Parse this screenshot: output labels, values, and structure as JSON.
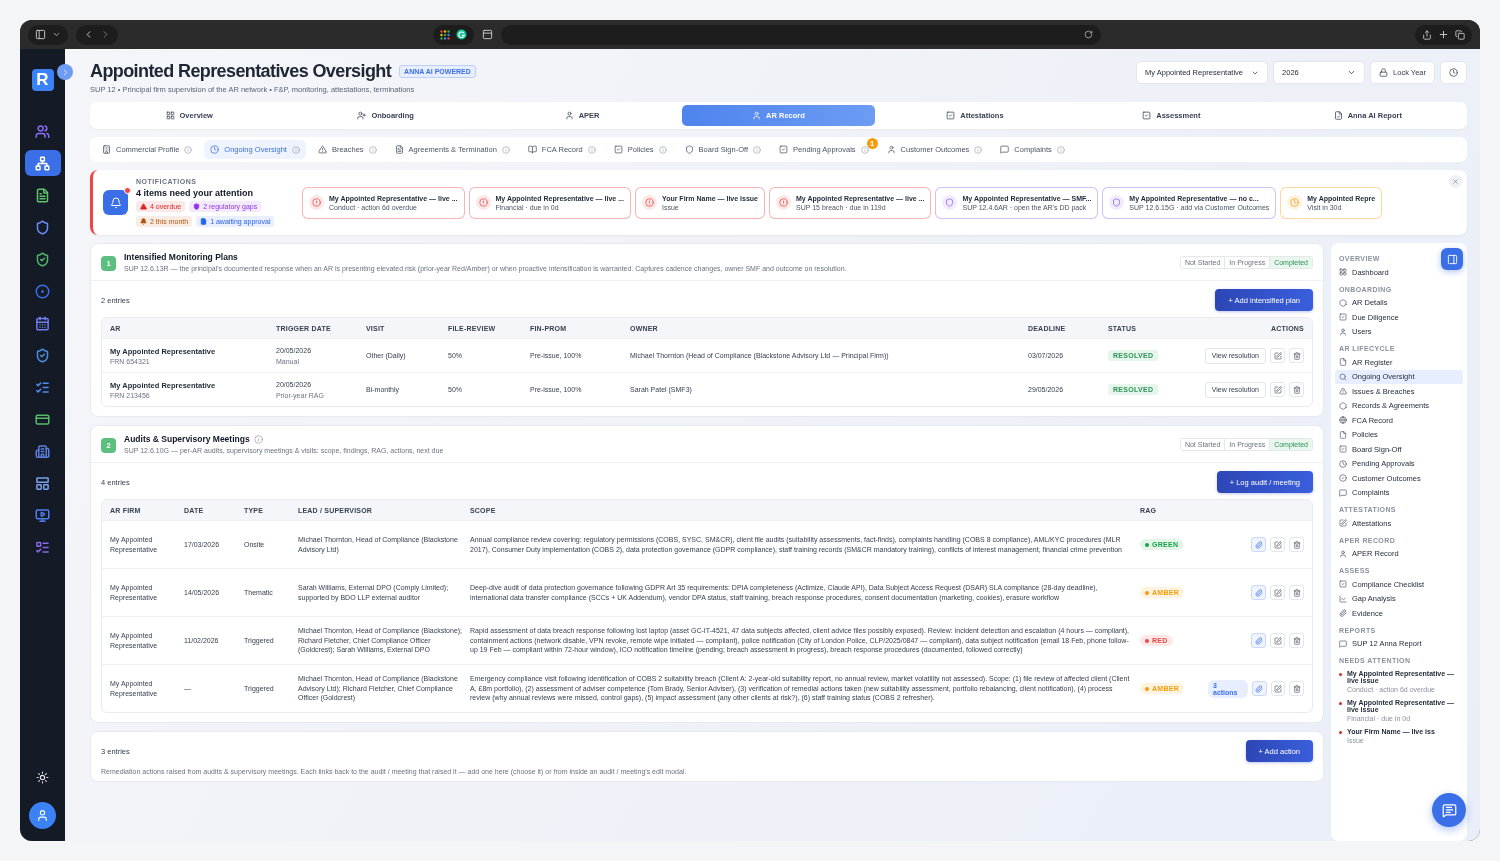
{
  "app": {
    "logo": "R"
  },
  "left_rail": {
    "items": [
      {
        "selected": false,
        "color": "#8b6cf6"
      },
      {
        "selected": true,
        "color": "#ffffff"
      },
      {
        "selected": false,
        "color": "#5cc46a"
      },
      {
        "selected": false,
        "color": "#6b8df5"
      },
      {
        "selected": false,
        "color": "#4fb86b"
      },
      {
        "selected": false,
        "color": "#3b6fe8"
      },
      {
        "selected": false,
        "color": "#6f7ff0"
      },
      {
        "selected": false,
        "color": "#4a90e2"
      },
      {
        "selected": false,
        "color": "#4f8bf0"
      },
      {
        "selected": false,
        "color": "#59b96a"
      },
      {
        "selected": false,
        "color": "#5a7fe0"
      },
      {
        "selected": false,
        "color": "#7aa0ee"
      },
      {
        "selected": false,
        "color": "#4f7df0"
      },
      {
        "selected": false,
        "color": "#8a67e8"
      }
    ]
  },
  "header": {
    "title": "Appointed Representatives Oversight",
    "badge": "ANNA AI POWERED",
    "subtitle": "SUP 12 • Principal firm supervision of the AR network • F&P, monitoring, attestations, terminations",
    "firm_select": "My Appointed Representative",
    "year_select": "2026",
    "lock_button": "Lock Year"
  },
  "tabs": [
    {
      "label": "Overview",
      "selected": false
    },
    {
      "label": "Onboarding",
      "selected": false
    },
    {
      "label": "APER",
      "selected": false
    },
    {
      "label": "AR Record",
      "selected": true
    },
    {
      "label": "Attestations",
      "selected": false
    },
    {
      "label": "Assessment",
      "selected": false
    },
    {
      "label": "Anna AI Report",
      "selected": false
    }
  ],
  "subtabs": [
    {
      "label": "Commercial Profile",
      "selected": false
    },
    {
      "label": "Ongoing Oversight",
      "selected": true
    },
    {
      "label": "Breaches",
      "selected": false
    },
    {
      "label": "Agreements & Termination",
      "selected": false
    },
    {
      "label": "FCA Record",
      "selected": false
    },
    {
      "label": "Policies",
      "selected": false
    },
    {
      "label": "Board Sign-Off",
      "selected": false
    },
    {
      "label": "Pending Approvals",
      "selected": false,
      "badge": "1"
    },
    {
      "label": "Customer Outcomes",
      "selected": false
    },
    {
      "label": "Complaints",
      "selected": false
    }
  ],
  "notifications": {
    "heading": "NOTIFICATIONS",
    "title": "4 items need your attention",
    "chips": [
      {
        "label": "4 overdue",
        "color": "#dc2626"
      },
      {
        "label": "2 regulatory gaps",
        "color": "#9333ea"
      },
      {
        "label": "2 this month",
        "color": "#b45309"
      },
      {
        "label": "1 awaiting approval",
        "color": "#2563eb"
      }
    ],
    "cards": [
      {
        "kind": "alert",
        "title": "My Appointed Representative — live ...",
        "detail": "Conduct · action 6d overdue"
      },
      {
        "kind": "alert",
        "title": "My Appointed Representative — live ...",
        "detail": "Financial · due in 0d"
      },
      {
        "kind": "alert",
        "title": "Your Firm Name — live issue",
        "detail": "Issue"
      },
      {
        "kind": "alert",
        "title": "My Appointed Representative — live ...",
        "detail": "SUP 15 breach · due in 119d"
      },
      {
        "kind": "shield",
        "title": "My Appointed Representative — SMF...",
        "detail": "SUP 12.4.6AR · open the AR's DD pack"
      },
      {
        "kind": "shield",
        "title": "My Appointed Representative — no c...",
        "detail": "SUP 12.6.15G · add via Customer Outcomes"
      },
      {
        "kind": "clock",
        "title": "My Appointed Repre",
        "detail": "Visit in 30d"
      }
    ]
  },
  "monitoring": {
    "number": "1",
    "title": "Intensified Monitoring Plans",
    "description": "SUP 12.6.13R — the principal's documented response when an AR is presenting elevated risk (prior-year Red/Amber) or when proactive intensification is warranted. Captures cadence changes, owner SMF and outcome on resolution.",
    "progress": [
      {
        "label": "Not Started",
        "selected": false
      },
      {
        "label": "In Progress",
        "selected": false
      },
      {
        "label": "Completed",
        "selected": true
      }
    ],
    "entries": "2 entries",
    "add_button": "+ Add intensified plan",
    "columns": [
      "AR",
      "TRIGGER DATE",
      "VISIT",
      "FILE-REVIEW",
      "FIN-PROM",
      "OWNER",
      "DEADLINE",
      "STATUS",
      "ACTIONS"
    ],
    "rows": [
      {
        "ar": "My Appointed Representative",
        "frn": "FRN 654321",
        "trigger_date": "20/05/2026",
        "trigger_note": "Manual",
        "visit": "Other (Daily)",
        "file_review": "50%",
        "fin_prom": "Pre-issue, 100%",
        "owner": "Michael Thornton (Head of Compliance (Blackstone Advisory Ltd — Principal Firm))",
        "deadline": "03/07/2026",
        "status": "RESOLVED",
        "action": "View resolution"
      },
      {
        "ar": "My Appointed Representative",
        "frn": "FRN 213456",
        "trigger_date": "20/05/2026",
        "trigger_note": "Prior-year RAG",
        "visit": "Bi-monthly",
        "file_review": "50%",
        "fin_prom": "Pre-issue, 100%",
        "owner": "Sarah Patel (SMF3)",
        "deadline": "29/05/2026",
        "status": "RESOLVED",
        "action": "View resolution"
      }
    ]
  },
  "audits": {
    "number": "2",
    "title": "Audits & Supervisory Meetings",
    "description": "SUP 12.6.10G — per-AR audits, supervisory meetings & visits: scope, findings, RAG, actions, next due",
    "progress": [
      {
        "label": "Not Started",
        "selected": false
      },
      {
        "label": "In Progress",
        "selected": false
      },
      {
        "label": "Completed",
        "selected": true
      }
    ],
    "entries": "4 entries",
    "add_button": "+ Log audit / meeting",
    "columns": [
      "AR FIRM",
      "DATE",
      "TYPE",
      "LEAD / SUPERVISOR",
      "SCOPE",
      "RAG"
    ],
    "rows": [
      {
        "ar_firm": "My Appointed Representative",
        "date": "17/03/2026",
        "type": "Onsite",
        "lead": "Michael Thornton, Head of Compliance (Blackstone Advisory Ltd)",
        "scope": "Annual compliance review covering: regulatory permissions (COBS, SYSC, SM&CR), client file audits (suitability assessments, fact-finds), complaints handling (COBS 8 compliance), AML/KYC procedures (MLR 2017), Consumer Duty implementation (COBS 2), data protection governance (GDPR compliance), staff training records (SM&CR mandatory training), conflicts of interest management, financial crime prevention",
        "rag": "GREEN",
        "color": "#16a34a"
      },
      {
        "ar_firm": "My Appointed Representative",
        "date": "14/05/2026",
        "type": "Thematic",
        "lead": "Sarah Williams, External DPO (Comply Limited); supported by BDO LLP external auditor",
        "scope": "Deep-dive audit of data protection governance following GDPR Art 35 requirements: DPIA completeness (Actimize, Claude API), Data Subject Access Request (DSAR) SLA compliance (28-day deadline), international data transfer compliance (SCCs + UK Addendum), vendor DPA status, staff training, breach response procedures, consent documentation (marketing, cookies), erasure workflow",
        "rag": "AMBER",
        "color": "#f59e0b"
      },
      {
        "ar_firm": "My Appointed Representative",
        "date": "11/02/2026",
        "type": "Triggered",
        "lead": "Michael Thornton, Head of Compliance (Blackstone); Richard Fletcher, Chief Compliance Officer (Goldcrest); Sarah Williams, External DPO",
        "scope": "Rapid assessment of data breach response following lost laptop (asset GC-IT-4521, 47 data subjects affected, client advice files possibly exposed). Review: incident detection and escalation (4 hours — compliant), containment actions (network disable, VPN revoke, remote wipe initiated — compliant), police notification (City of London Police, CLP/2025/0847 — compliant), data subject notification (email 18 Feb, phone follow-up 19 Feb — compliant within 72-hour window), ICO notification timeline (pending; breach assessment in progress), breach response procedures (documented, followed correctly)",
        "rag": "RED",
        "color": "#ef4444"
      },
      {
        "ar_firm": "My Appointed Representative",
        "date": "—",
        "type": "Triggered",
        "lead": "Michael Thornton, Head of Compliance (Blackstone Advisory Ltd); Richard Fletcher, Chief Compliance Officer (Goldcrest)",
        "scope": "Emergency compliance visit following identification of COBS 2 suitability breach (Client A: 2-year-old suitability report, no annual review, market volatility not assessed). Scope: (1) file review of affected client (Client A, £8m portfolio), (2) assessment of adviser competence (Tom Brady, Senior Adviser), (3) verification of remedial actions taken (new suitability assessment, portfolio rebalancing, client notification), (4) process review (why annual reviews were missed, control gaps), (5) impact assessment (any other clients at risk?), (6) staff training status (COBS 2 refresher).",
        "rag": "AMBER",
        "color": "#f59e0b",
        "actions_badge": "3 actions"
      }
    ]
  },
  "remediation": {
    "entries": "3 entries",
    "add_button": "+ Add action",
    "description": "Remediation actions raised from audits & supervisory meetings. Each links back to the audit / meeting that raised it — add one here (choose it) or from inside an audit / meeting's edit modal."
  },
  "side_nav": {
    "groups": [
      {
        "heading": "OVERVIEW",
        "items": [
          {
            "label": "Dashboard",
            "selected": false
          }
        ]
      },
      {
        "heading": "ONBOARDING",
        "items": [
          {
            "label": "AR Details",
            "selected": false
          },
          {
            "label": "Due Diligence",
            "selected": false
          },
          {
            "label": "Users",
            "selected": false
          }
        ]
      },
      {
        "heading": "AR LIFECYCLE",
        "items": [
          {
            "label": "AR Register",
            "selected": false
          },
          {
            "label": "Ongoing Oversight",
            "selected": true
          },
          {
            "label": "Issues & Breaches",
            "selected": false
          },
          {
            "label": "Records & Agreements",
            "selected": false
          },
          {
            "label": "FCA Record",
            "selected": false
          },
          {
            "label": "Policies",
            "selected": false
          },
          {
            "label": "Board Sign-Off",
            "selected": false
          },
          {
            "label": "Pending Approvals",
            "selected": false
          },
          {
            "label": "Customer Outcomes",
            "selected": false
          },
          {
            "label": "Complaints",
            "selected": false
          }
        ]
      },
      {
        "heading": "ATTESTATIONS",
        "items": [
          {
            "label": "Attestations",
            "selected": false
          }
        ]
      },
      {
        "heading": "APER RECORD",
        "items": [
          {
            "label": "APER Record",
            "selected": false
          }
        ]
      },
      {
        "heading": "ASSESS",
        "items": [
          {
            "label": "Compliance Checklist",
            "selected": false
          },
          {
            "label": "Gap Analysis",
            "selected": false
          },
          {
            "label": "Evidence",
            "selected": false
          }
        ]
      },
      {
        "heading": "REPORTS",
        "items": [
          {
            "label": "SUP 12 Anna Report",
            "selected": false
          }
        ]
      }
    ],
    "attention_heading": "NEEDS ATTENTION",
    "attention": [
      {
        "title": "My Appointed Representative — live issue",
        "detail": "Conduct · action 6d overdue"
      },
      {
        "title": "My Appointed Representative — live issue",
        "detail": "Financial · due in 0d"
      },
      {
        "title": "Your Firm Name — live iss",
        "detail": "Issue"
      }
    ]
  }
}
